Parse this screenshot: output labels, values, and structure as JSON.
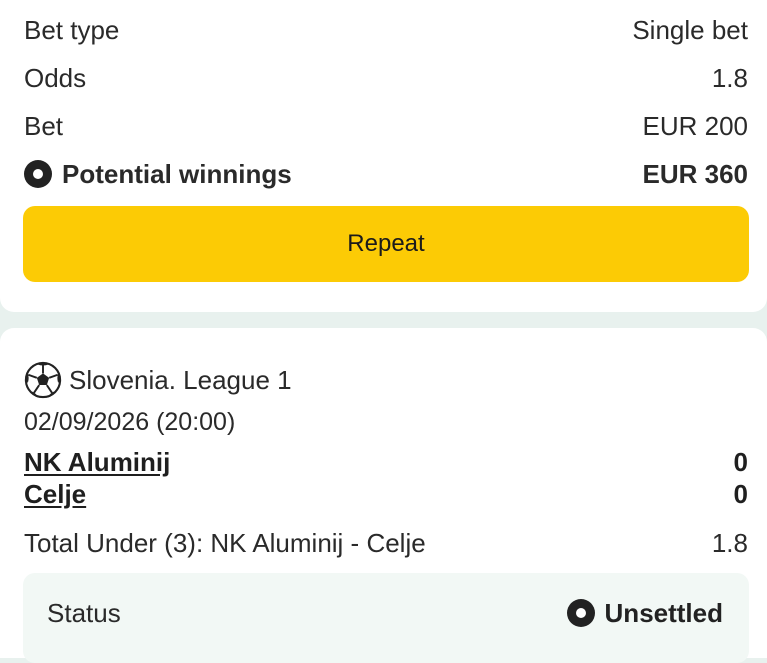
{
  "bet_summary": {
    "bet_type_label": "Bet type",
    "bet_type_value": "Single bet",
    "odds_label": "Odds",
    "odds_value": "1.8",
    "bet_label": "Bet",
    "bet_value": "EUR 200",
    "potential_label": "Potential winnings",
    "potential_value": "EUR 360",
    "potential_icon": "radio-dot-icon",
    "repeat_label": "Repeat",
    "repeat_color": "#fccb05"
  },
  "event": {
    "sport_icon": "soccer-ball-icon",
    "league": "Slovenia. League 1",
    "datetime": "02/09/2026 (20:00)",
    "teams": [
      {
        "name": "NK Aluminij",
        "score": "0"
      },
      {
        "name": "Celje",
        "score": "0"
      }
    ],
    "market": "Total Under (3): NK Aluminij - Celje",
    "market_odds": "1.8",
    "status_label": "Status",
    "status_value": "Unsettled",
    "status_icon": "radio-dot-icon"
  }
}
